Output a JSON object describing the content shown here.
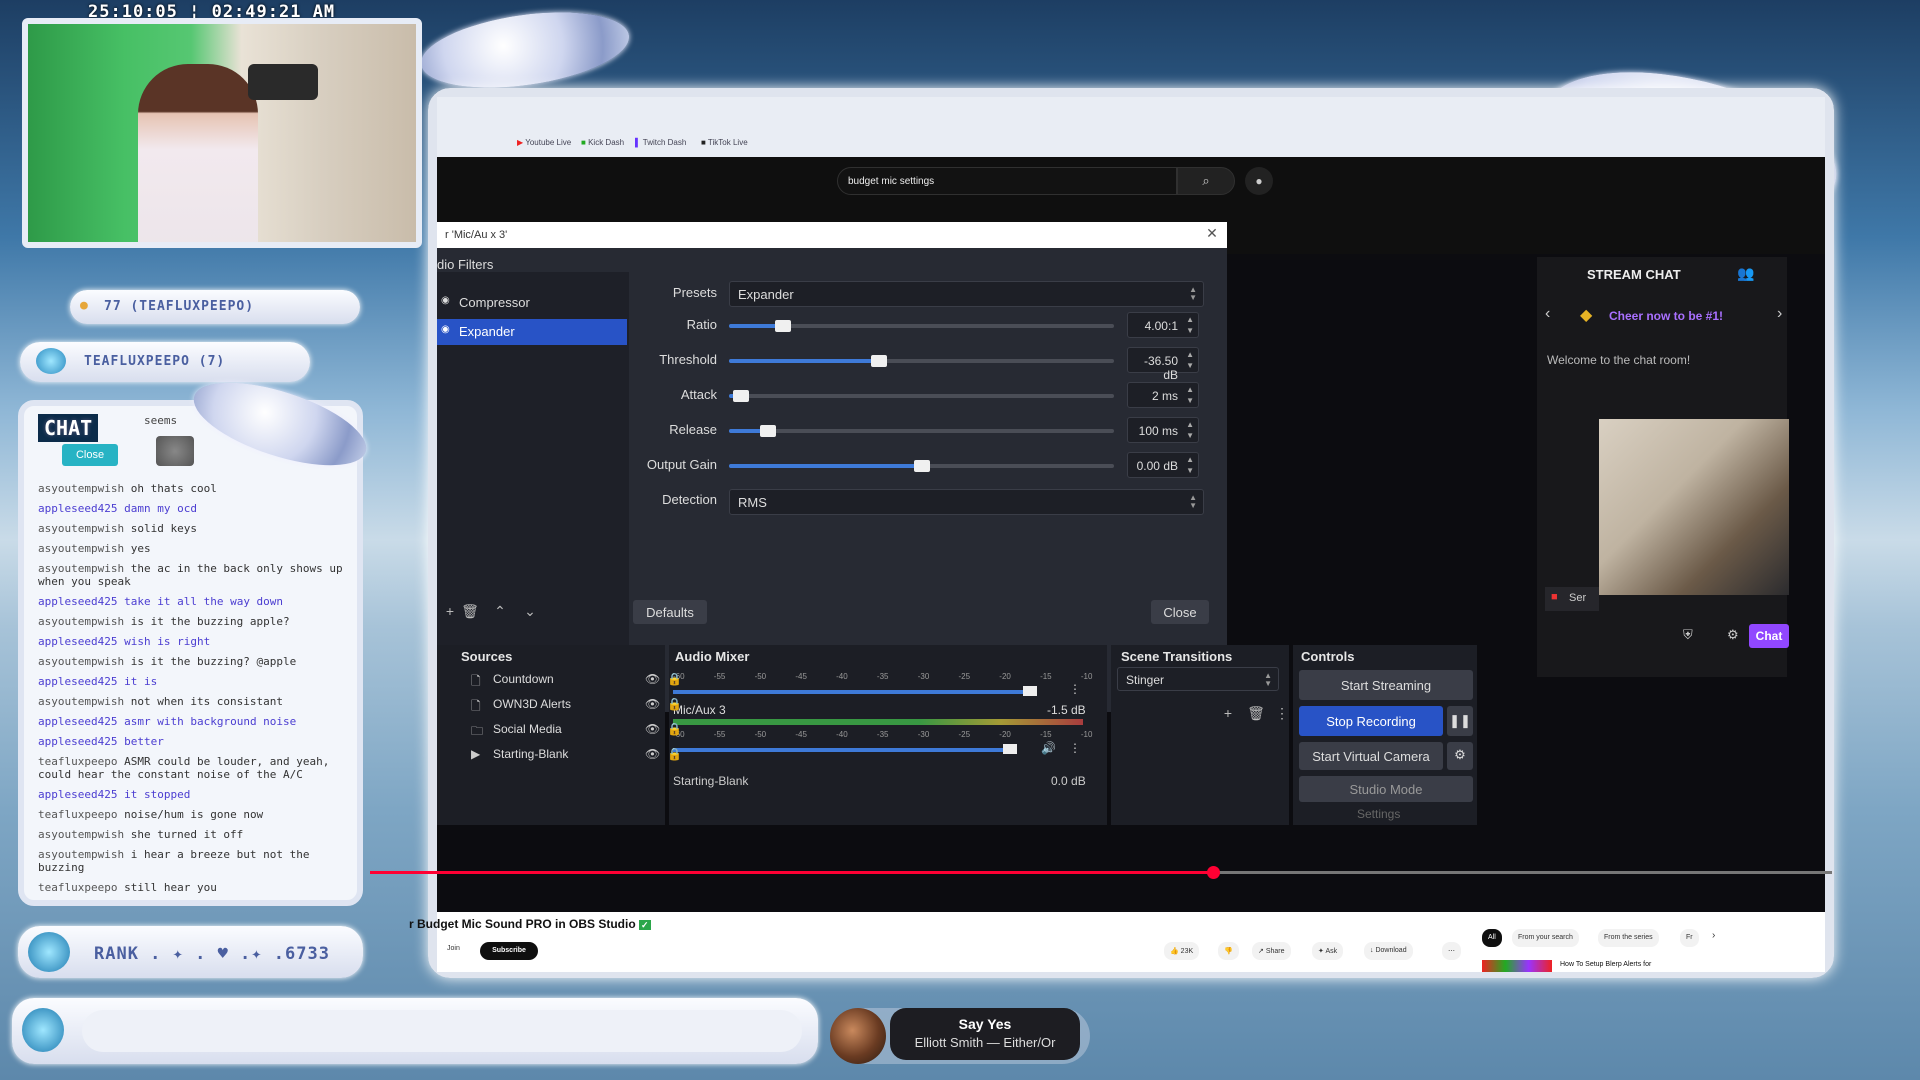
{
  "overlay": {
    "timestamp": "25:10:05 ¦ 02:49:21 AM",
    "donor_pill": "77 (TEAFLUXPEEPO)",
    "sub_pill": "TEAFLUXPEEPO (7)",
    "rank": "RANK . ✦ . ♥ .✦ .6733"
  },
  "bookmarks": [
    "Youtube Live",
    "Kick Dash",
    "Twitch Dash",
    "TikTok Live"
  ],
  "youtube": {
    "search_value": "budget mic settings",
    "video_title": "r Budget Mic Sound PRO in OBS Studio",
    "subscribe": "Subscribe",
    "join": "Join",
    "likes": "23K",
    "share": "Share",
    "ask": "Ask",
    "download": "Download",
    "chips": [
      "All",
      "From your search",
      "From the series",
      "Fr"
    ],
    "suggested": "How To Setup Blerp Alerts for"
  },
  "obs_filters": {
    "title": "r 'Mic/Au x 3'",
    "section": "dio Filters",
    "filters": [
      "Compressor",
      "Expander"
    ],
    "presets_label": "Presets",
    "preset_value": "Expander",
    "rows": [
      {
        "label": "Ratio",
        "value": "4.00:1",
        "level": 0.14
      },
      {
        "label": "Threshold",
        "value": "-36.50 dB",
        "level": 0.39
      },
      {
        "label": "Attack",
        "value": "2 ms",
        "level": 0.03
      },
      {
        "label": "Release",
        "value": "100 ms",
        "level": 0.1
      },
      {
        "label": "Output Gain",
        "value": "0.00 dB",
        "level": 0.5
      }
    ],
    "detection_label": "Detection",
    "detection_value": "RMS",
    "defaults": "Defaults",
    "close": "Close"
  },
  "obs_main": {
    "sources_hdr": "Sources",
    "sources": [
      "Countdown",
      "OWN3D Alerts",
      "Social Media",
      "Starting-Blank"
    ],
    "mixer_hdr": "Audio Mixer",
    "ruler": "-60 -55 -50 -45 -40 -35 -30 -25 -20 -15 -10 -5 0",
    "ch1_name": "Mic/Aux 3",
    "ch1_db": "-1.5 dB",
    "ch2_name": "Starting-Blank",
    "ch2_db": "0.0 dB",
    "trans_hdr": "Scene Transitions",
    "trans_value": "Stinger",
    "controls_hdr": "Controls",
    "start_streaming": "Start Streaming",
    "stop_recording": "Stop Recording",
    "virtual_cam": "Start Virtual Camera",
    "studio_mode": "Studio Mode",
    "settings": "Settings"
  },
  "stream_chat": {
    "title": "STREAM CHAT",
    "cheer": "Cheer now to be #1!",
    "welcome": "Welcome to the chat room!",
    "chat_btn": "Chat",
    "send_label": "Ser"
  },
  "overlay_chat": {
    "title": "CHAT",
    "close": "Close",
    "snippet": "seems",
    "messages": [
      {
        "user": "asyoutempwish",
        "text": "oh thats cool",
        "alt": false
      },
      {
        "user": "appleseed425",
        "text": "damn my ocd",
        "alt": true
      },
      {
        "user": "asyoutempwish",
        "text": "solid keys",
        "alt": false
      },
      {
        "user": "asyoutempwish",
        "text": "yes",
        "alt": false
      },
      {
        "user": "asyoutempwish",
        "text": "the ac in the back only shows up when you speak",
        "alt": false
      },
      {
        "user": "appleseed425",
        "text": "take it all the way down",
        "alt": true
      },
      {
        "user": "asyoutempwish",
        "text": "is it the buzzing apple?",
        "alt": false
      },
      {
        "user": "appleseed425",
        "text": "wish is right",
        "alt": true
      },
      {
        "user": "asyoutempwish",
        "text": "is it the buzzing? @apple",
        "alt": false
      },
      {
        "user": "appleseed425",
        "text": "it is",
        "alt": true
      },
      {
        "user": "asyoutempwish",
        "text": "not when its consistant",
        "alt": false
      },
      {
        "user": "appleseed425",
        "text": "asmr with background noise",
        "alt": true
      },
      {
        "user": "appleseed425",
        "text": "better",
        "alt": true
      },
      {
        "user": "teafluxpeepo",
        "text": "ASMR could be louder, and yeah, could hear the constant noise of the A/C",
        "alt": false
      },
      {
        "user": "appleseed425",
        "text": "it stopped",
        "alt": true
      },
      {
        "user": "teafluxpeepo",
        "text": "noise/hum is gone now",
        "alt": false
      },
      {
        "user": "asyoutempwish",
        "text": "she turned it off",
        "alt": false
      },
      {
        "user": "asyoutempwish",
        "text": "i hear a breeze but not the buzzing",
        "alt": false
      },
      {
        "user": "teafluxpeepo",
        "text": "still hear you",
        "alt": false
      }
    ]
  },
  "now_playing": {
    "title": "Say Yes",
    "artist": "Elliott Smith — Either/Or"
  },
  "colors": {
    "accent": "#2853c6",
    "chat_purple": "#9147ff",
    "cheer": "#a970ff",
    "progress_red": "#ff0033"
  }
}
